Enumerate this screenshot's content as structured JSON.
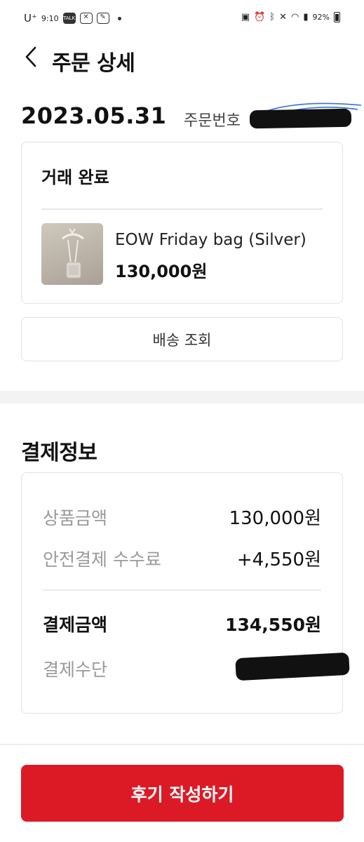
{
  "status_bar": {
    "carrier": "U⁺",
    "time": "9:10",
    "icons_left": [
      "talk-icon",
      "missed-call-icon",
      "edit-icon",
      "dot-icon"
    ],
    "icons_right": [
      "battery-saver-icon",
      "alarm-icon",
      "bluetooth-icon",
      "mute-icon",
      "wifi-icon",
      "signal-icon"
    ],
    "battery": "92%"
  },
  "header": {
    "title": "주문 상세",
    "back_icon": "chevron-left-icon"
  },
  "order": {
    "date": "2023.05.31",
    "number_label": "주문번호"
  },
  "trade": {
    "status": "거래 완료",
    "product_name": "EOW Friday bag (Silver)",
    "product_price": "130,000원"
  },
  "shipping_button": "배송 조회",
  "payment": {
    "title": "결제정보",
    "rows": [
      {
        "label": "상품금액",
        "value": "130,000원"
      },
      {
        "label": "안전결제 수수료",
        "value": "+4,550원"
      }
    ],
    "total": {
      "label": "결제금액",
      "value": "134,550원"
    },
    "method_label": "결제수단"
  },
  "review_button": "후기 작성하기",
  "colors": {
    "accent": "#dc1a26",
    "muted_text": "#9a9a9a",
    "border": "#e2e2e2"
  }
}
